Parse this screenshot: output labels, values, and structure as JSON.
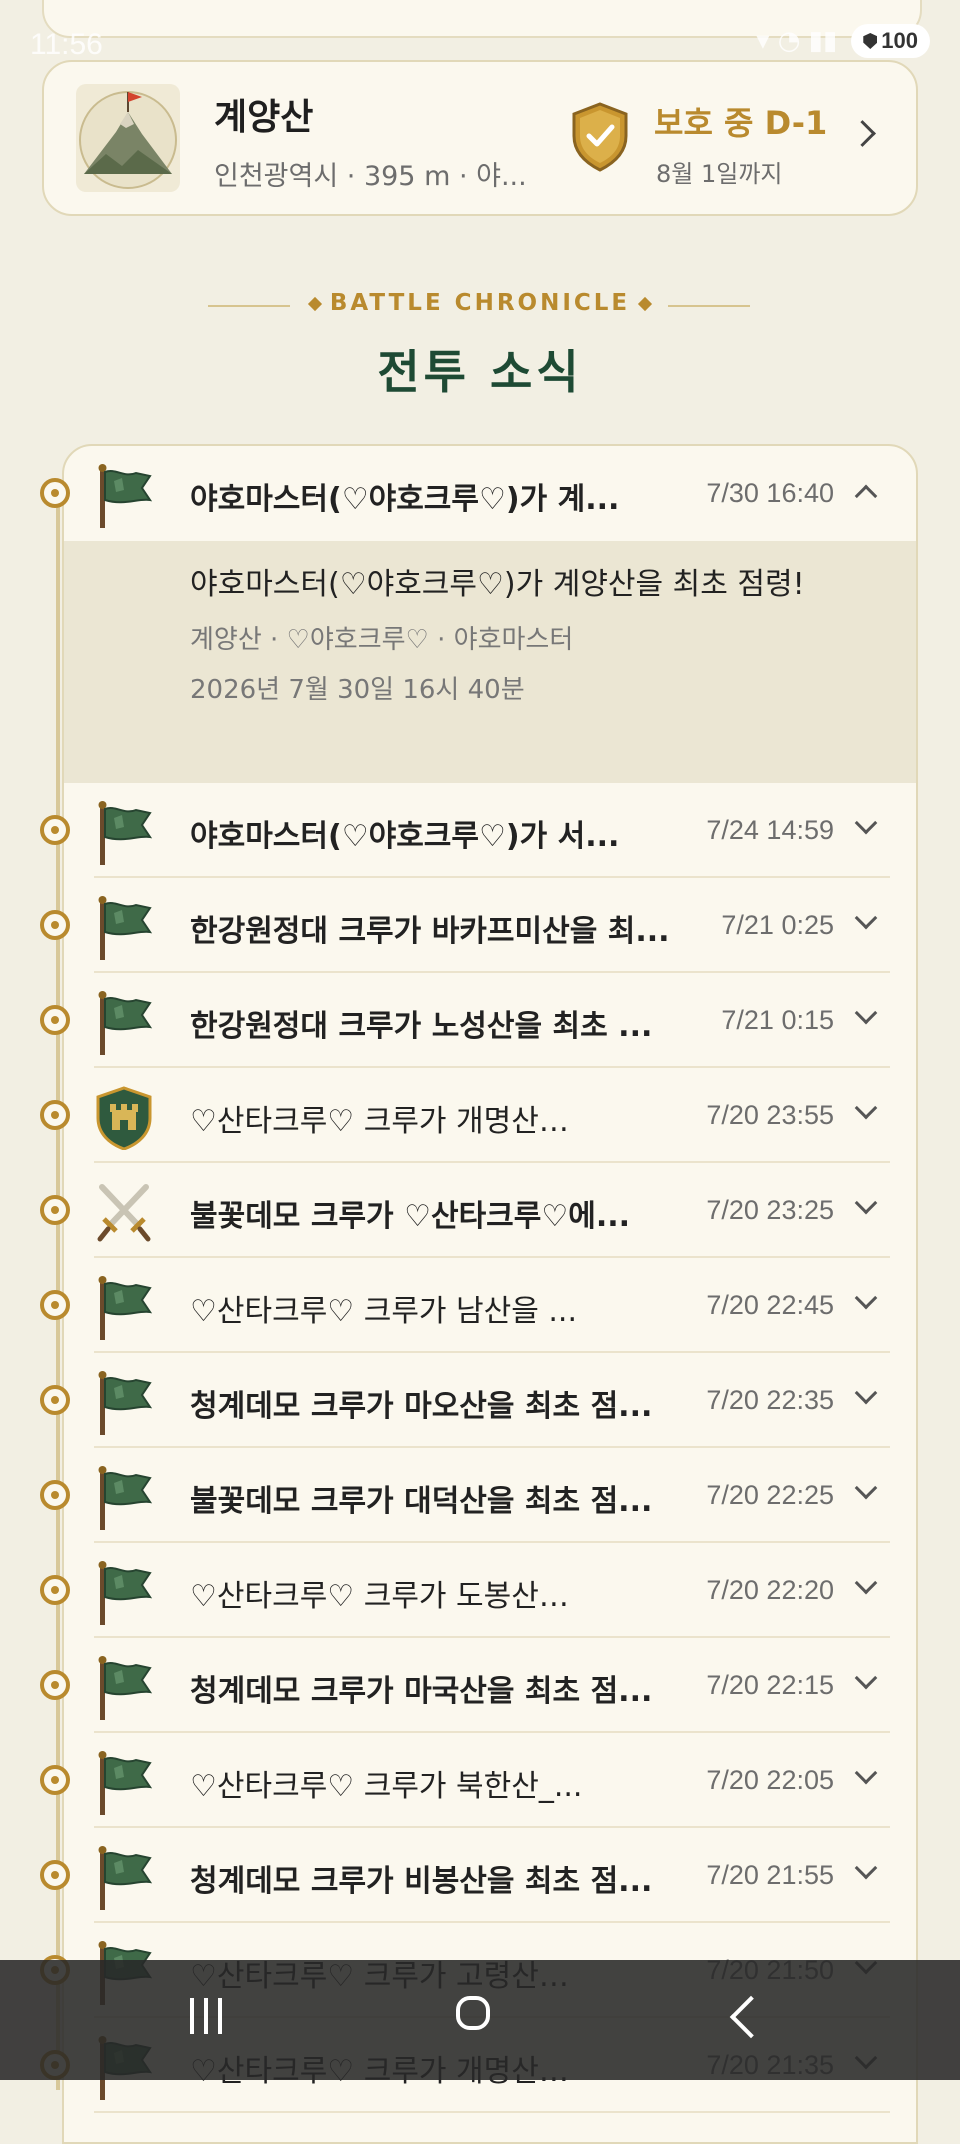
{
  "status_bar": {
    "time": "11:56",
    "battery": "100"
  },
  "mountain_card": {
    "name": "계양산",
    "subtitle": "인천광역시 · 395 m · 야...",
    "protect_status": "보호 중 D-1",
    "protect_until": "8월 1일까지"
  },
  "section": {
    "eyebrow": "BATTLE CHRONICLE",
    "title": "전투 소식"
  },
  "feed": {
    "expanded": {
      "message": "야호마스터(♡야호크루♡)가 계양산을 최초 점령!",
      "meta": "계양산 · ♡야호크루♡ · 야호마스터",
      "date": "2026년 7월 30일 16시 40분"
    },
    "items": [
      {
        "icon": "flag",
        "title": "야호마스터(♡야호크루♡)가 계...",
        "time": "7/30 16:40",
        "bold": true,
        "expanded": true
      },
      {
        "icon": "flag",
        "title": "야호마스터(♡야호크루♡)가 서...",
        "time": "7/24 14:59",
        "bold": true
      },
      {
        "icon": "flag",
        "title": "한강원정대 크루가 바카프미산을 최...",
        "time": "7/21 0:25",
        "bold": true
      },
      {
        "icon": "flag",
        "title": "한강원정대 크루가 노성산을 최초 ...",
        "time": "7/21 0:15",
        "bold": true
      },
      {
        "icon": "castle",
        "title": "♡산타크루♡ 크루가 개명산…",
        "time": "7/20 23:55",
        "bold": false
      },
      {
        "icon": "swords",
        "title": "불꽃데모 크루가 ♡산타크루♡에...",
        "time": "7/20 23:25",
        "bold": true
      },
      {
        "icon": "flag",
        "title": "♡산타크루♡ 크루가 남산을 ...",
        "time": "7/20 22:45",
        "bold": false
      },
      {
        "icon": "flag",
        "title": "청계데모 크루가 마오산을 최초 점...",
        "time": "7/20 22:35",
        "bold": true
      },
      {
        "icon": "flag",
        "title": "불꽃데모 크루가 대덕산을 최초 점...",
        "time": "7/20 22:25",
        "bold": true
      },
      {
        "icon": "flag",
        "title": "♡산타크루♡ 크루가 도봉산…",
        "time": "7/20 22:20",
        "bold": false
      },
      {
        "icon": "flag",
        "title": "청계데모 크루가 마국산을 최초 점...",
        "time": "7/20 22:15",
        "bold": true
      },
      {
        "icon": "flag",
        "title": "♡산타크루♡ 크루가 북한산_...",
        "time": "7/20 22:05",
        "bold": false
      },
      {
        "icon": "flag",
        "title": "청계데모 크루가 비봉산을 최초 점...",
        "time": "7/20 21:55",
        "bold": true
      },
      {
        "icon": "flag",
        "title": "♡산타크루♡ 크루가 고령산…",
        "time": "7/20 21:50",
        "bold": false
      },
      {
        "icon": "flag",
        "title": "♡산타크루♡ 크루가 개명산…",
        "time": "7/20 21:35",
        "bold": false
      }
    ]
  }
}
